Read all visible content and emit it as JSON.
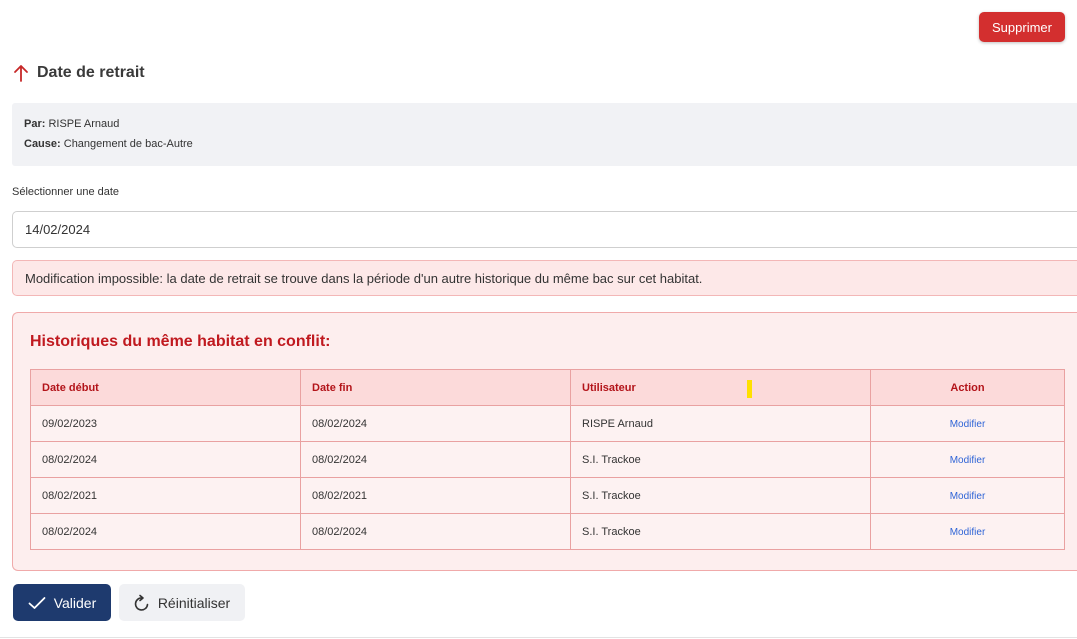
{
  "header": {
    "delete_label": "Supprimer",
    "title": "Date de retrait"
  },
  "info": {
    "par_label": "Par:",
    "par_value": "RISPE Arnaud",
    "cause_label": "Cause:",
    "cause_value": "Changement de bac-Autre"
  },
  "date_field": {
    "label": "Sélectionner une date",
    "value": "14/02/2024"
  },
  "error": {
    "message": "Modification impossible: la date de retrait se trouve dans la période d'un autre historique du même bac sur cet habitat."
  },
  "conflicts": {
    "title": "Historiques du même habitat en conflit:",
    "columns": [
      "Date début",
      "Date fin",
      "Utilisateur",
      "Action"
    ],
    "rows": [
      {
        "start": "09/02/2023",
        "end": "08/02/2024",
        "user": "RISPE Arnaud",
        "action": "Modifier"
      },
      {
        "start": "08/02/2024",
        "end": "08/02/2024",
        "user": "S.I. Trackoe",
        "action": "Modifier"
      },
      {
        "start": "08/02/2021",
        "end": "08/02/2021",
        "user": "S.I. Trackoe",
        "action": "Modifier"
      },
      {
        "start": "08/02/2024",
        "end": "08/02/2024",
        "user": "S.I. Trackoe",
        "action": "Modifier"
      }
    ]
  },
  "actions": {
    "submit_label": "Valider",
    "reset_label": "Réinitialiser"
  },
  "colors": {
    "primary": "#1e3a6e",
    "danger": "#d32f2f",
    "conflict_title": "#c0191f",
    "link": "#2f64d6"
  },
  "icons": {
    "title": "arrow-up-icon",
    "submit": "check-icon",
    "reset": "refresh-icon"
  }
}
